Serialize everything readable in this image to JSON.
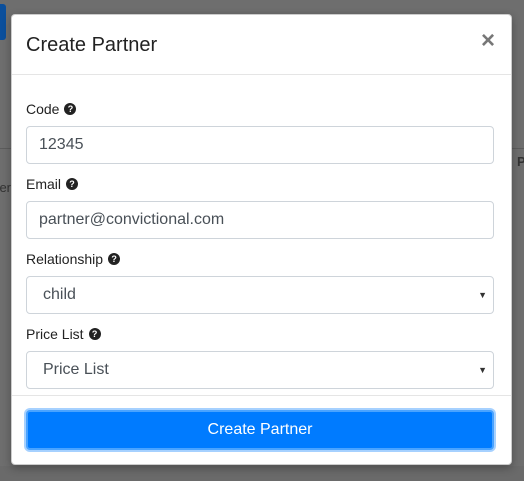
{
  "modal": {
    "title": "Create Partner",
    "close_label": "×"
  },
  "form": {
    "code": {
      "label": "Code",
      "value": "12345",
      "help_icon": "question-circle-icon"
    },
    "email": {
      "label": "Email",
      "value": "partner@convictional.com",
      "help_icon": "question-circle-icon"
    },
    "relationship": {
      "label": "Relationship",
      "selected": "child",
      "help_icon": "question-circle-icon"
    },
    "price_list": {
      "label": "Price List",
      "selected": "Price List",
      "help_icon": "question-circle-icon"
    }
  },
  "footer": {
    "submit_label": "Create Partner"
  },
  "colors": {
    "primary": "#007bff",
    "overlay": "#6e6e6e"
  }
}
